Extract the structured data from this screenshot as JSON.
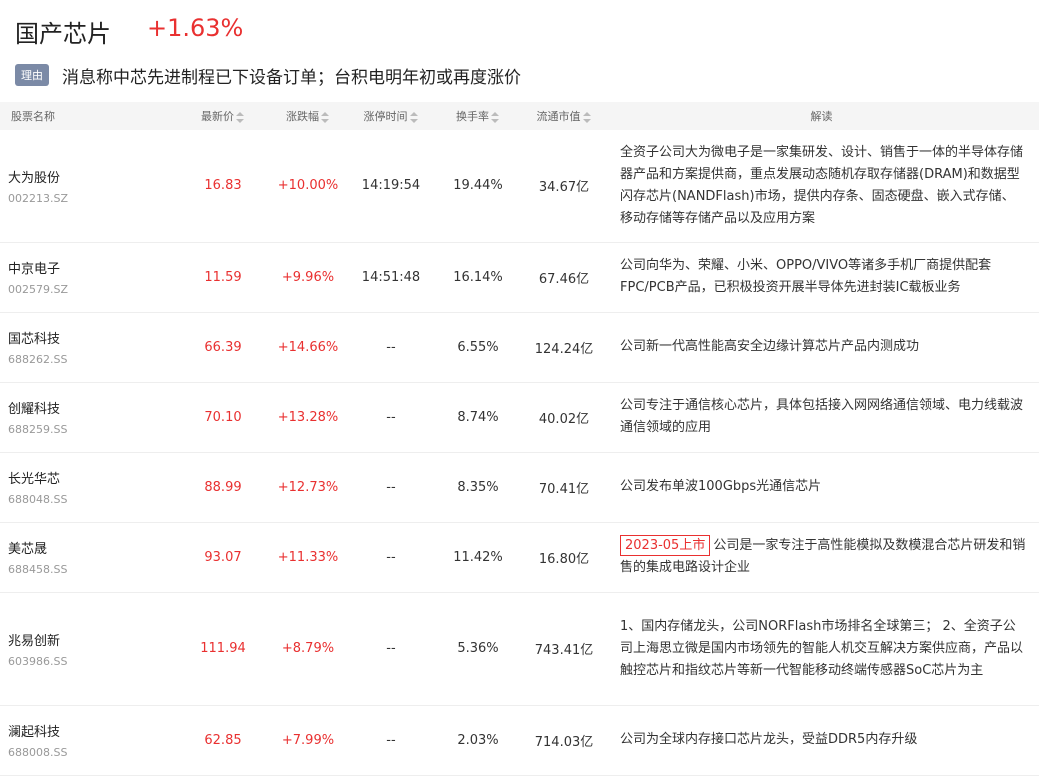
{
  "header": {
    "title": "国产芯片",
    "change": "+1.63%"
  },
  "reason": {
    "tag": "理由",
    "text": "消息称中芯先进制程已下设备订单；台积电明年初或再度涨价"
  },
  "table": {
    "columns": {
      "name": "股票名称",
      "price": "最新价",
      "change": "涨跌幅",
      "limit_time": "涨停时间",
      "turnover": "换手率",
      "mktcap": "流通市值",
      "desc": "解读"
    },
    "rows": [
      {
        "name": "大为股份",
        "code": "002213.SZ",
        "price": "16.83",
        "change": "+10.00%",
        "limit_time": "14:19:54",
        "turnover": "19.44%",
        "mktcap": "34.67亿",
        "tag": "",
        "desc": "全资子公司大为微电子是一家集研发、设计、销售于一体的半导体存储器产品和方案提供商，重点发展动态随机存取存储器(DRAM)和数据型闪存芯片(NANDFlash)市场，提供内存条、固态硬盘、嵌入式存储、移动存储等存储产品以及应用方案"
      },
      {
        "name": "中京电子",
        "code": "002579.SZ",
        "price": "11.59",
        "change": "+9.96%",
        "limit_time": "14:51:48",
        "turnover": "16.14%",
        "mktcap": "67.46亿",
        "tag": "",
        "desc": "公司向华为、荣耀、小米、OPPO/VIVO等诸多手机厂商提供配套FPC/PCB产品，已积极投资开展半导体先进封装IC载板业务"
      },
      {
        "name": "国芯科技",
        "code": "688262.SS",
        "price": "66.39",
        "change": "+14.66%",
        "limit_time": "--",
        "turnover": "6.55%",
        "mktcap": "124.24亿",
        "tag": "",
        "desc": "公司新一代高性能高安全边缘计算芯片产品内测成功"
      },
      {
        "name": "创耀科技",
        "code": "688259.SS",
        "price": "70.10",
        "change": "+13.28%",
        "limit_time": "--",
        "turnover": "8.74%",
        "mktcap": "40.02亿",
        "tag": "",
        "desc": "公司专注于通信核心芯片，具体包括接入网网络通信领域、电力线载波通信领域的应用"
      },
      {
        "name": "长光华芯",
        "code": "688048.SS",
        "price": "88.99",
        "change": "+12.73%",
        "limit_time": "--",
        "turnover": "8.35%",
        "mktcap": "70.41亿",
        "tag": "",
        "desc": "公司发布单波100Gbps光通信芯片"
      },
      {
        "name": "美芯晟",
        "code": "688458.SS",
        "price": "93.07",
        "change": "+11.33%",
        "limit_time": "--",
        "turnover": "11.42%",
        "mktcap": "16.80亿",
        "tag": "2023-05上市",
        "desc": "公司是一家专注于高性能模拟及数模混合芯片研发和销售的集成电路设计企业"
      },
      {
        "name": "兆易创新",
        "code": "603986.SS",
        "price": "111.94",
        "change": "+8.79%",
        "limit_time": "--",
        "turnover": "5.36%",
        "mktcap": "743.41亿",
        "tag": "",
        "desc": "1、国内存储龙头，公司NORFlash市场排名全球第三； 2、全资子公司上海思立微是国内市场领先的智能人机交互解决方案供应商，产品以触控芯片和指纹芯片等新一代智能移动终端传感器SoC芯片为主"
      },
      {
        "name": "澜起科技",
        "code": "688008.SS",
        "price": "62.85",
        "change": "+7.99%",
        "limit_time": "--",
        "turnover": "2.03%",
        "mktcap": "714.03亿",
        "tag": "",
        "desc": "公司为全球内存接口芯片龙头，受益DDR5内存升级"
      }
    ]
  }
}
